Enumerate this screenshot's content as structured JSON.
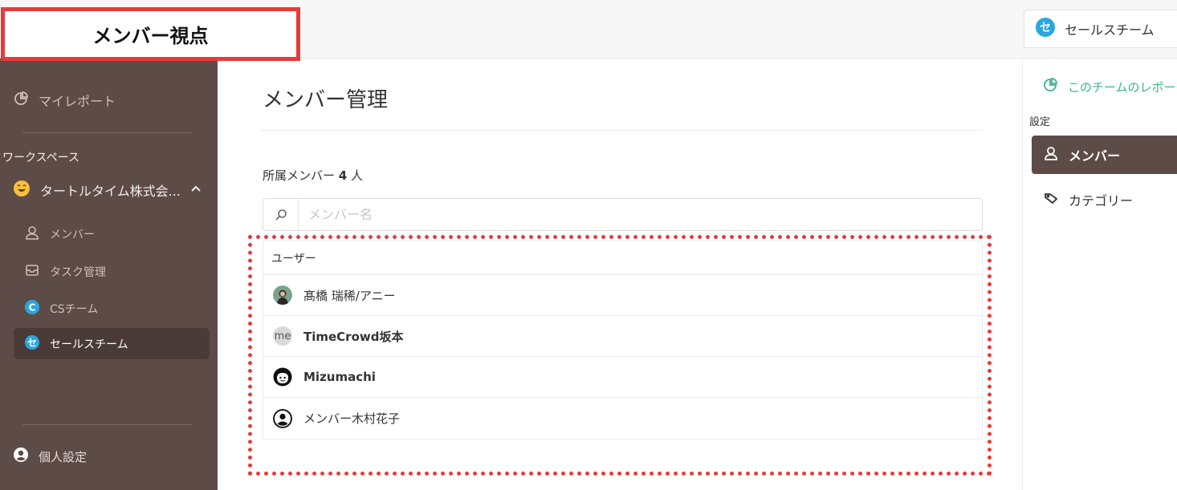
{
  "banner": {
    "label": "メンバー視点"
  },
  "header": {
    "team_switcher": {
      "icon": "team-se-icon",
      "name": "セールスチーム",
      "icon_color": "#2aa7e0"
    }
  },
  "sidebar": {
    "my_report": "マイレポート",
    "workspace_label": "ワークスペース",
    "org": {
      "name": "タートルタイム株式会...",
      "emoji": "grinning-face-icon"
    },
    "items": [
      {
        "label": "メンバー",
        "icon": "user-icon"
      },
      {
        "label": "タスク管理",
        "icon": "inbox-icon"
      },
      {
        "label": "CSチーム",
        "icon": "team-c-icon",
        "badge_letter": "C",
        "badge_color": "#2aa7e0"
      },
      {
        "label": "セールスチーム",
        "icon": "team-se-icon",
        "badge_letter": "セ",
        "badge_color": "#2aa7e0",
        "active": true
      }
    ],
    "personal_settings": "個人設定"
  },
  "main": {
    "title": "メンバー管理",
    "member_count": {
      "prefix": "所属メンバー",
      "count": "4",
      "suffix": "人"
    },
    "search": {
      "placeholder": "メンバー名",
      "value": ""
    },
    "table": {
      "header": "ユーザー",
      "rows": [
        {
          "name": "髙橋 瑞稀/アニー",
          "avatar": "photo-avatar",
          "bold": false
        },
        {
          "name": "TimeCrowd坂本",
          "avatar": "me-avatar",
          "avatar_text": "me",
          "bold": true
        },
        {
          "name": "Mizumachi",
          "avatar": "face-avatar",
          "bold": true
        },
        {
          "name": "メンバー木村花子",
          "avatar": "person-avatar",
          "bold": false
        }
      ]
    }
  },
  "right_panel": {
    "report_link": "このチームのレポート",
    "settings_label": "設定",
    "items": [
      {
        "label": "メンバー",
        "icon": "user-icon",
        "active": true
      },
      {
        "label": "カテゴリー",
        "icon": "tag-icon",
        "active": false
      }
    ]
  },
  "colors": {
    "sidebar_bg": "#5d4b48",
    "accent_red": "#e83a3a",
    "link_green": "#3cb38f",
    "team_blue": "#2aa7e0"
  }
}
